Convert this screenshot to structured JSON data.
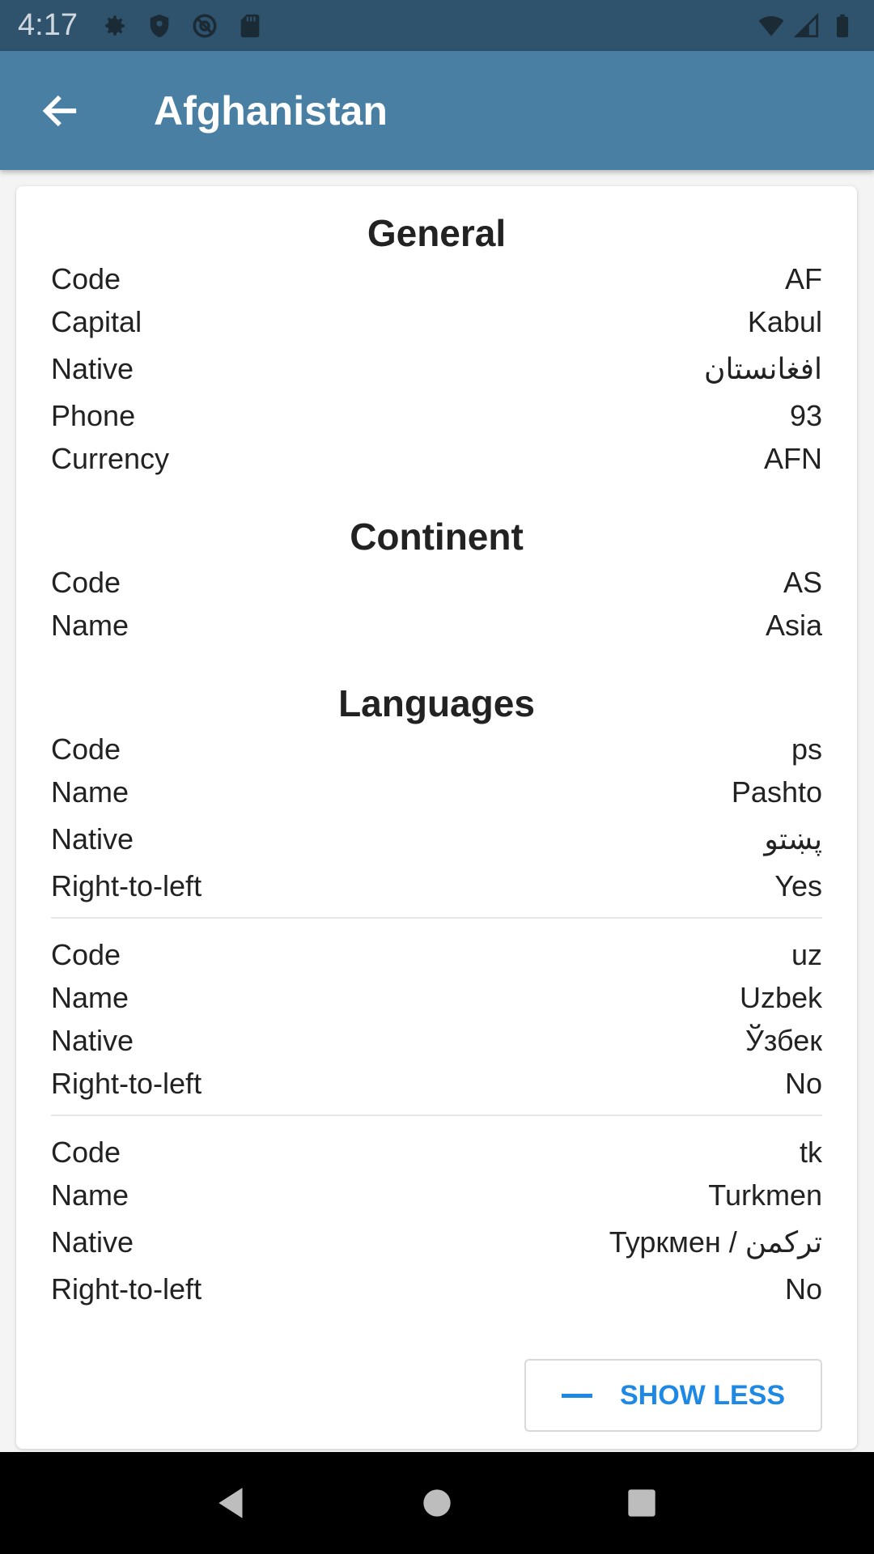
{
  "status_bar": {
    "time": "4:17",
    "icons_left": [
      "gear-icon",
      "shield-icon",
      "at-icon",
      "sd-card-icon"
    ],
    "icons_right": [
      "wifi-icon",
      "signal-icon",
      "battery-icon"
    ]
  },
  "app_bar": {
    "title": "Afghanistan",
    "back_icon": "arrow-left-icon"
  },
  "general": {
    "title": "General",
    "rows": [
      {
        "label": "Code",
        "value": "AF"
      },
      {
        "label": "Capital",
        "value": "Kabul"
      },
      {
        "label": "Native",
        "value": "افغانستان"
      },
      {
        "label": "Phone",
        "value": "93"
      },
      {
        "label": "Currency",
        "value": "AFN"
      }
    ]
  },
  "continent": {
    "title": "Continent",
    "rows": [
      {
        "label": "Code",
        "value": "AS"
      },
      {
        "label": "Name",
        "value": "Asia"
      }
    ]
  },
  "languages": {
    "title": "Languages",
    "items": [
      [
        {
          "label": "Code",
          "value": "ps"
        },
        {
          "label": "Name",
          "value": "Pashto"
        },
        {
          "label": "Native",
          "value": "پښتو"
        },
        {
          "label": "Right-to-left",
          "value": "Yes"
        }
      ],
      [
        {
          "label": "Code",
          "value": "uz"
        },
        {
          "label": "Name",
          "value": "Uzbek"
        },
        {
          "label": "Native",
          "value": "Ўзбек"
        },
        {
          "label": "Right-to-left",
          "value": "No"
        }
      ],
      [
        {
          "label": "Code",
          "value": "tk"
        },
        {
          "label": "Name",
          "value": "Turkmen"
        },
        {
          "label": "Native",
          "value": "Туркмен / تركمن"
        },
        {
          "label": "Right-to-left",
          "value": "No"
        }
      ]
    ]
  },
  "show_less": {
    "label": "SHOW LESS",
    "icon": "minus-icon"
  },
  "colors": {
    "status_bar": "#2f536d",
    "app_bar": "#4a7fa4",
    "accent": "#1e88e5"
  }
}
